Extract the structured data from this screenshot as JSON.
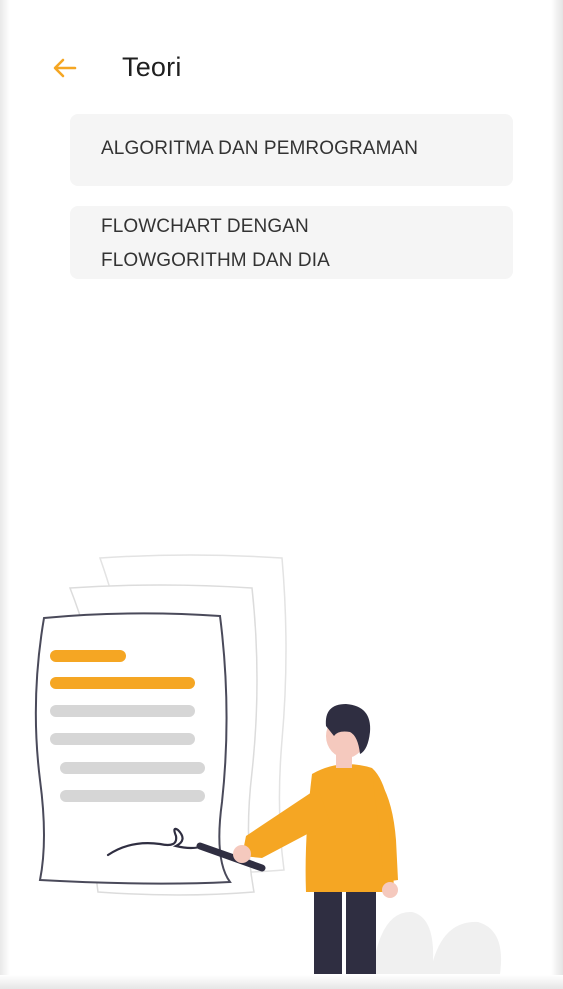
{
  "header": {
    "back_icon": "arrow-left-icon",
    "title": "Teori"
  },
  "menu": {
    "items": [
      {
        "label": "ALGORITMA DAN PEMROGRAMAN"
      },
      {
        "label": "FLOWCHART DENGAN FLOWGORITHM DAN DIA"
      }
    ]
  },
  "illustration": {
    "name": "person-signing-document",
    "colors": {
      "accent": "#F5A623",
      "line_gray": "#D6D6D6",
      "outline": "#4A4A5A",
      "shirt": "#F5A623",
      "pants": "#2F2E41",
      "skin": "#F5C9BE",
      "hair": "#2F2E41"
    }
  },
  "theme": {
    "accent": "#F5A623",
    "card_bg": "#F5F5F5",
    "text": "#333333"
  }
}
